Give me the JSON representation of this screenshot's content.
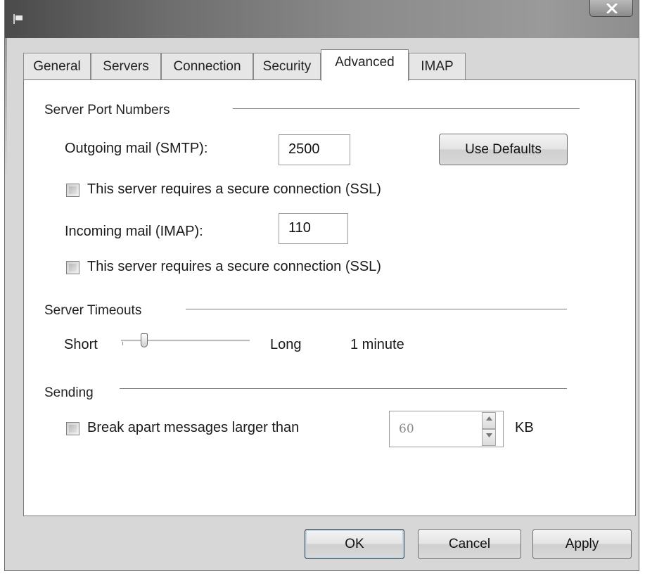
{
  "tabs": [
    {
      "label": "General"
    },
    {
      "label": "Servers"
    },
    {
      "label": "Connection"
    },
    {
      "label": "Security"
    },
    {
      "label": "Advanced",
      "active": true
    },
    {
      "label": "IMAP"
    }
  ],
  "ports": {
    "section_title": "Server Port Numbers",
    "outgoing_label": "Outgoing mail (SMTP):",
    "outgoing_value": "2500",
    "use_defaults_label": "Use Defaults",
    "outgoing_ssl_label": "This server requires a secure connection (SSL)",
    "outgoing_ssl_checked": false,
    "incoming_label": "Incoming mail (IMAP):",
    "incoming_value": "110",
    "incoming_ssl_label": "This server requires a secure connection (SSL)",
    "incoming_ssl_checked": false
  },
  "timeouts": {
    "section_title": "Server Timeouts",
    "short_label": "Short",
    "long_label": "Long",
    "value_label": "1 minute",
    "slider_fraction": 0.16
  },
  "sending": {
    "section_title": "Sending",
    "break_apart_label": "Break apart messages larger than",
    "break_apart_checked": false,
    "size_value": "60",
    "unit_label": "KB"
  },
  "buttons": {
    "ok": "OK",
    "cancel": "Cancel",
    "apply": "Apply"
  },
  "icons": {
    "title": "app-flag-icon",
    "close": "close-icon",
    "spin_up": "spin-up-arrow-icon",
    "spin_down": "spin-down-arrow-icon"
  }
}
